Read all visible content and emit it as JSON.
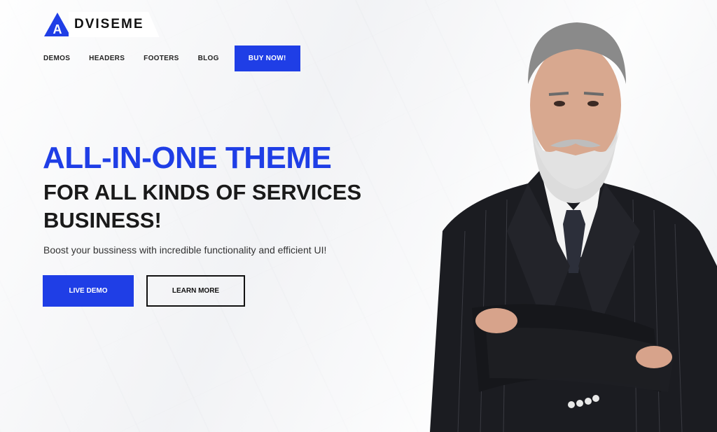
{
  "brand": {
    "mark_letter": "A",
    "name": "DVISEME",
    "accent": "#1f3ee6"
  },
  "nav": {
    "items": [
      {
        "label": "DEMOS"
      },
      {
        "label": "HEADERS"
      },
      {
        "label": "FOOTERS"
      },
      {
        "label": "BLOG"
      }
    ],
    "cta_label": "BUY NOW!"
  },
  "hero": {
    "title": "ALL-IN-ONE THEME",
    "subtitle_line1": "FOR ALL KINDS OF SERVICES",
    "subtitle_line2": "BUSINESS!",
    "description": "Boost your bussiness with incredible functionality and efficient UI!",
    "primary_button": "LIVE DEMO",
    "secondary_button": "LEARN MORE"
  },
  "image": {
    "icon": "businessman-portrait"
  }
}
